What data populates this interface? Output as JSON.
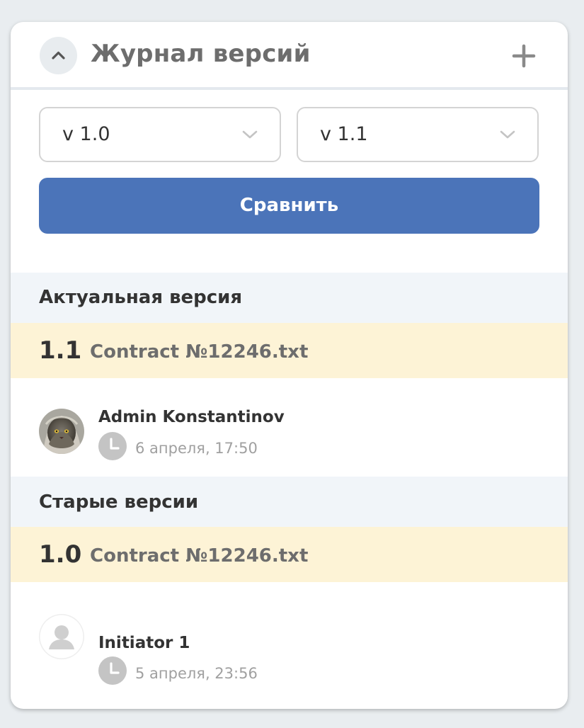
{
  "header": {
    "title": "Журнал версий",
    "collapse_icon": "chevron-up-icon",
    "add_icon": "plus-icon"
  },
  "compare": {
    "from_version": "v 1.0",
    "to_version": "v 1.1",
    "button_label": "Сравнить"
  },
  "current_section": {
    "title": "Актуальная версия",
    "version": {
      "number": "1.1",
      "file_name": "Contract №12246.txt",
      "author": "Admin Konstantinov",
      "date": "6 апреля, 17:50"
    }
  },
  "old_section": {
    "title": "Старые версии",
    "versions": [
      {
        "number": "1.0",
        "file_name": "Contract №12246.txt",
        "author": "Initiator 1",
        "date": "5 апреля, 23:56"
      }
    ]
  },
  "colors": {
    "accent": "#4b74b9",
    "row_highlight": "#fdf3d6",
    "section_bg": "#f1f5f9"
  }
}
